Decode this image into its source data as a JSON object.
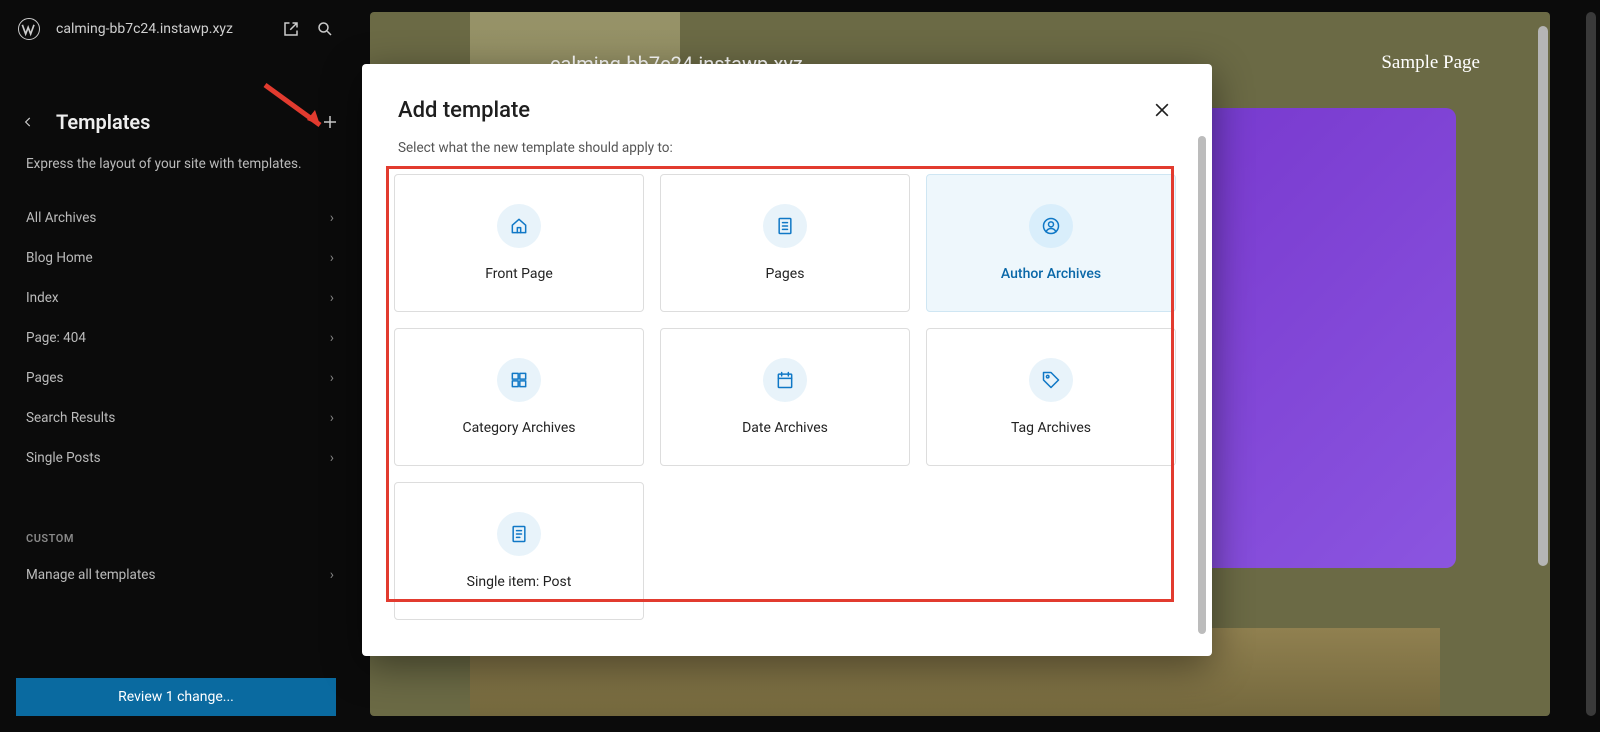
{
  "topbar": {
    "site_url": "calming-bb7c24.instawp.xyz"
  },
  "sidebar": {
    "title": "Templates",
    "description": "Express the layout of your site with templates.",
    "items": [
      {
        "label": "All Archives"
      },
      {
        "label": "Blog Home"
      },
      {
        "label": "Index"
      },
      {
        "label": "Page: 404"
      },
      {
        "label": "Pages"
      },
      {
        "label": "Search Results"
      },
      {
        "label": "Single Posts"
      }
    ],
    "custom_heading": "CUSTOM",
    "manage_all": "Manage all templates",
    "review_button": "Review 1 change..."
  },
  "canvas": {
    "url_text": "calming-bb7c24.instawp.xyz",
    "sample_link": "Sample Page"
  },
  "modal": {
    "title": "Add template",
    "description": "Select what the new template should apply to:",
    "options": [
      {
        "label": "Front Page",
        "icon": "home-icon"
      },
      {
        "label": "Pages",
        "icon": "page-icon"
      },
      {
        "label": "Author Archives",
        "icon": "author-icon",
        "hover": true
      },
      {
        "label": "Category Archives",
        "icon": "grid-icon"
      },
      {
        "label": "Date Archives",
        "icon": "calendar-icon"
      },
      {
        "label": "Tag Archives",
        "icon": "tag-icon"
      },
      {
        "label": "Single item: Post",
        "icon": "post-icon"
      }
    ]
  }
}
